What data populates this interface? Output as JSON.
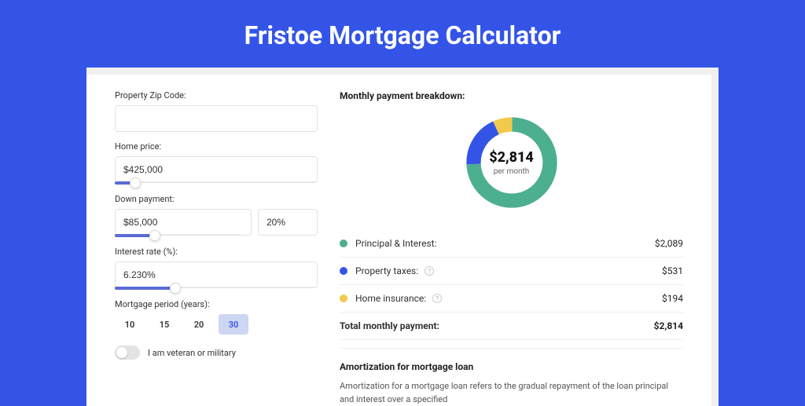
{
  "title": "Fristoe Mortgage Calculator",
  "form": {
    "zip_label": "Property Zip Code:",
    "zip_value": "",
    "home_price_label": "Home price:",
    "home_price_value": "$425,000",
    "home_price_slider_pct": 10,
    "down_payment_label": "Down payment:",
    "down_payment_value": "$85,000",
    "down_payment_pct_value": "20%",
    "down_payment_slider_pct": 20,
    "interest_label": "Interest rate (%):",
    "interest_value": "6.230%",
    "interest_slider_pct": 30,
    "period_label": "Mortgage period (years):",
    "periods": [
      "10",
      "15",
      "20",
      "30"
    ],
    "period_selected": "30",
    "veteran_label": "I am veteran or military",
    "veteran_checked": false
  },
  "breakdown": {
    "heading": "Monthly payment breakdown:",
    "center_amount": "$2,814",
    "center_sub": "per month",
    "items": [
      {
        "key": "principal_interest",
        "label": "Principal & Interest:",
        "value": "$2,089",
        "color": "#4caf8f",
        "help": false
      },
      {
        "key": "property_taxes",
        "label": "Property taxes:",
        "value": "$531",
        "color": "#3454e8",
        "help": true
      },
      {
        "key": "home_insurance",
        "label": "Home insurance:",
        "value": "$194",
        "color": "#f2c94c",
        "help": true
      }
    ],
    "total_label": "Total monthly payment:",
    "total_value": "$2,814"
  },
  "chart_data": {
    "type": "pie",
    "title": "Monthly payment breakdown",
    "series": [
      {
        "name": "Principal & Interest",
        "value": 2089,
        "color": "#4caf8f"
      },
      {
        "name": "Property taxes",
        "value": 531,
        "color": "#3454e8"
      },
      {
        "name": "Home insurance",
        "value": 194,
        "color": "#f2c94c"
      }
    ],
    "center_label": "$2,814 per month"
  },
  "amortization": {
    "heading": "Amortization for mortgage loan",
    "text": "Amortization for a mortgage loan refers to the gradual repayment of the loan principal and interest over a specified"
  }
}
